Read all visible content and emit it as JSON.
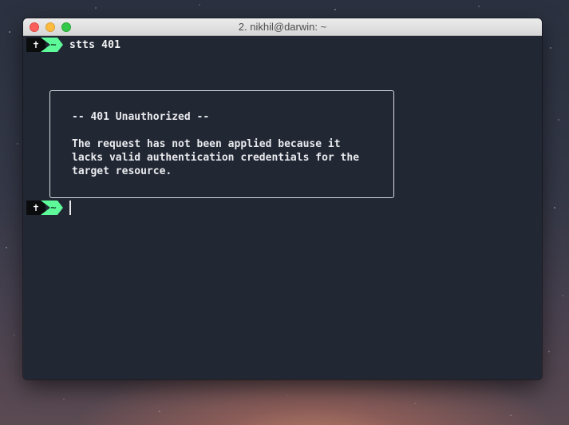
{
  "window": {
    "title": "2. nikhil@darwin: ~"
  },
  "prompt": {
    "root_symbol": "✝",
    "path": "~"
  },
  "command": "stts 401",
  "response": {
    "heading": "-- 401 Unauthorized --",
    "lines": [
      "The request has not been applied because it",
      "lacks valid authentication credentials for the",
      "target resource."
    ]
  },
  "colors": {
    "prompt_green": "#5efa9a",
    "terminal_bg": "#222734"
  }
}
